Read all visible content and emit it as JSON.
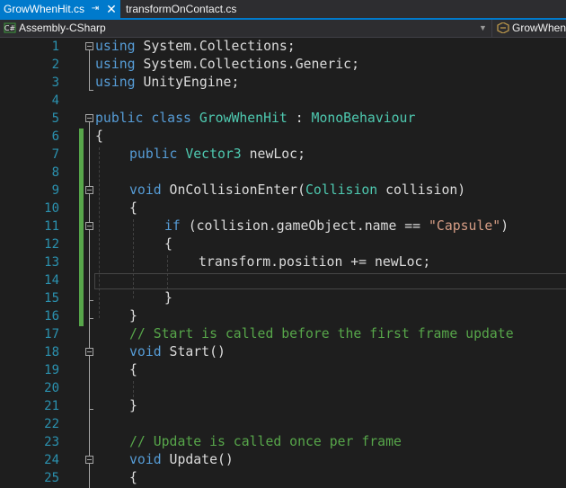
{
  "tabs": [
    {
      "label": "GrowWhenHit.cs",
      "pin_icon": "pin-icon",
      "close_icon": "close-icon",
      "active": true
    },
    {
      "label": "transformOnContact.cs",
      "active": false
    }
  ],
  "navbar": {
    "project": "Assembly-CSharp",
    "class_member": "GrowWhenHit"
  },
  "colors": {
    "accent": "#007acc",
    "keyword": "#569cd6",
    "type": "#4ec9b0",
    "string": "#d69d85",
    "comment": "#57a64a",
    "line_number": "#2b91af"
  },
  "editor": {
    "line_numbers": [
      "1",
      "2",
      "3",
      "4",
      "5",
      "6",
      "7",
      "8",
      "9",
      "10",
      "11",
      "12",
      "13",
      "14",
      "15",
      "16",
      "17",
      "18",
      "19",
      "20",
      "21",
      "22",
      "23",
      "24",
      "25"
    ],
    "code": {
      "l1_kw": "using",
      "l1_rest": " System.Collections;",
      "l2_kw": "using",
      "l2_rest": " System.Collections.Generic;",
      "l3_kw": "using",
      "l3_rest": " UnityEngine;",
      "l5_kw1": "public",
      "l5_kw2": " class",
      "l5_name": " GrowWhenHit",
      "l5_colon": " : ",
      "l5_base": "MonoBehaviour",
      "l6": "{",
      "l7_kw": "public",
      "l7_type": " Vector3",
      "l7_rest": " newLoc;",
      "l9_kw": "void",
      "l9_name": " OnCollisionEnter(",
      "l9_type": "Collision",
      "l9_rest": " collision)",
      "l10": "{",
      "l11_kw": "if",
      "l11_rest": " (collision.gameObject.name == ",
      "l11_str": "\"Capsule\"",
      "l11_end": ")",
      "l12": "{",
      "l13": "transform.position += newLoc;",
      "l15": "}",
      "l16": "}",
      "l17": "// Start is called before the first frame update",
      "l18_kw": "void",
      "l18_rest": " Start()",
      "l19": "{",
      "l21": "}",
      "l23": "// Update is called once per frame",
      "l24_kw": "void",
      "l24_rest": " Update()",
      "l25": "{"
    }
  }
}
